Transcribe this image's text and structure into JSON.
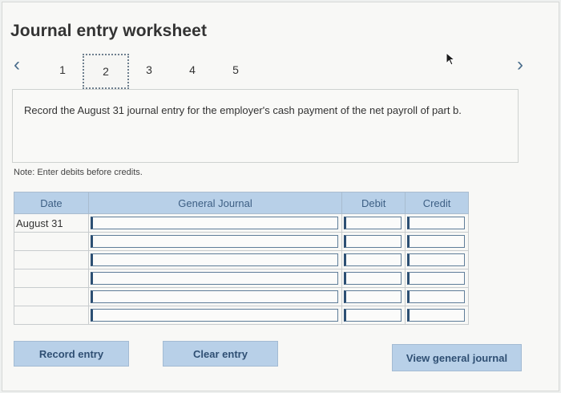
{
  "worksheet": {
    "title": "Journal entry worksheet",
    "tabs": [
      {
        "label": "1",
        "active": false
      },
      {
        "label": "2",
        "active": true
      },
      {
        "label": "3",
        "active": false
      },
      {
        "label": "4",
        "active": false
      },
      {
        "label": "5",
        "active": false
      }
    ],
    "nav": {
      "prev_icon": "chevron-left-icon",
      "next_icon": "chevron-right-icon"
    },
    "instruction": "Record the August 31 journal entry for the employer's cash payment of the net payroll of part b.",
    "note": "Note: Enter debits before credits.",
    "table": {
      "headers": {
        "date": "Date",
        "journal": "General Journal",
        "debit": "Debit",
        "credit": "Credit"
      },
      "rows": [
        {
          "date": "August 31",
          "account": "",
          "debit": "",
          "credit": ""
        },
        {
          "date": "",
          "account": "",
          "debit": "",
          "credit": ""
        },
        {
          "date": "",
          "account": "",
          "debit": "",
          "credit": ""
        },
        {
          "date": "",
          "account": "",
          "debit": "",
          "credit": ""
        },
        {
          "date": "",
          "account": "",
          "debit": "",
          "credit": ""
        },
        {
          "date": "",
          "account": "",
          "debit": "",
          "credit": ""
        }
      ]
    },
    "buttons": {
      "record": "Record entry",
      "clear": "Clear entry",
      "view": "View general journal"
    },
    "colors": {
      "accent": "#b8d0e8",
      "accent_text": "#2f4f73"
    }
  }
}
